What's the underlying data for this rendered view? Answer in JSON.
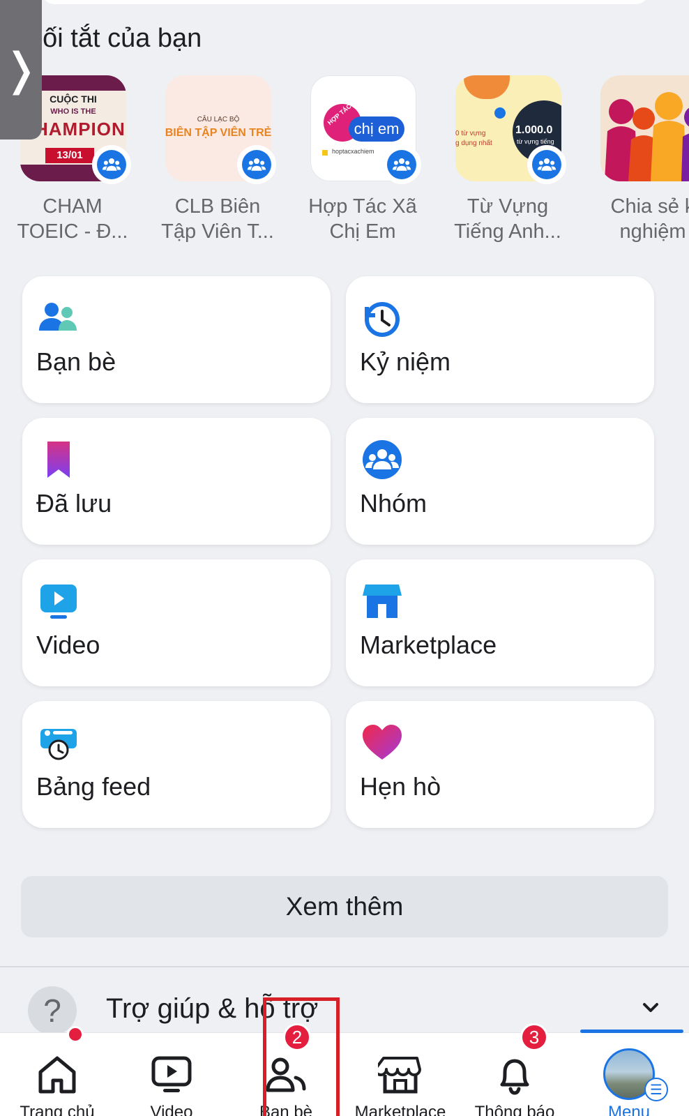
{
  "shortcuts_title": "Lối tắt của bạn",
  "side_handle_icon": "chevron-right-icon",
  "shortcuts": [
    {
      "line1": "CHAM",
      "line2": "TOEIC - Đ...",
      "thumb_lines": [
        "CUỘC THI",
        "WHO IS THE",
        "CHAMPION",
        "13/01"
      ]
    },
    {
      "line1": "CLB Biên",
      "line2": "Tập Viên T...",
      "thumb_lines": [
        "CÂU LẠC BỘ",
        "BIÊN TẬP VIÊN TRẺ"
      ]
    },
    {
      "line1": "Hợp Tác Xã",
      "line2": "Chị Em",
      "thumb_lines": [
        "HỢP TÁC XÃ",
        "chị em",
        "hoptacxachiem"
      ]
    },
    {
      "line1": "Từ Vựng",
      "line2": "Tiếng Anh...",
      "thumb_lines": [
        "1.000.0",
        "từ vựng tiếng",
        "0 từ vựng",
        "g dụng nhất"
      ]
    },
    {
      "line1": "Chia sẻ k",
      "line2": "nghiệm",
      "thumb_lines": []
    }
  ],
  "menu": [
    {
      "label": "Bạn bè",
      "icon": "friends-icon"
    },
    {
      "label": "Kỷ niệm",
      "icon": "memories-clock-icon"
    },
    {
      "label": "Đã lưu",
      "icon": "saved-bookmark-icon"
    },
    {
      "label": "Nhóm",
      "icon": "groups-icon"
    },
    {
      "label": "Video",
      "icon": "video-icon"
    },
    {
      "label": "Marketplace",
      "icon": "marketplace-store-icon"
    },
    {
      "label": "Bảng feed",
      "icon": "feeds-icon"
    },
    {
      "label": "Hẹn hò",
      "icon": "dating-heart-icon"
    }
  ],
  "see_more": "Xem thêm",
  "help": {
    "label": "Trợ giúp & hỗ trợ",
    "icon": "question-icon"
  },
  "tabs": [
    {
      "label": "Trang chủ",
      "icon": "home-icon"
    },
    {
      "label": "Video",
      "icon": "video-tab-icon"
    },
    {
      "label": "Bạn bè",
      "icon": "friends-tab-icon",
      "badge": "2"
    },
    {
      "label": "Marketplace",
      "icon": "marketplace-tab-icon"
    },
    {
      "label": "Thông báo",
      "icon": "bell-icon",
      "badge": "3"
    },
    {
      "label": "Menu",
      "icon": "avatar-menu-icon",
      "active": true
    }
  ],
  "colors": {
    "accent": "#1b74e4",
    "badge": "#e41e3f",
    "highlight": "#d61f26"
  }
}
